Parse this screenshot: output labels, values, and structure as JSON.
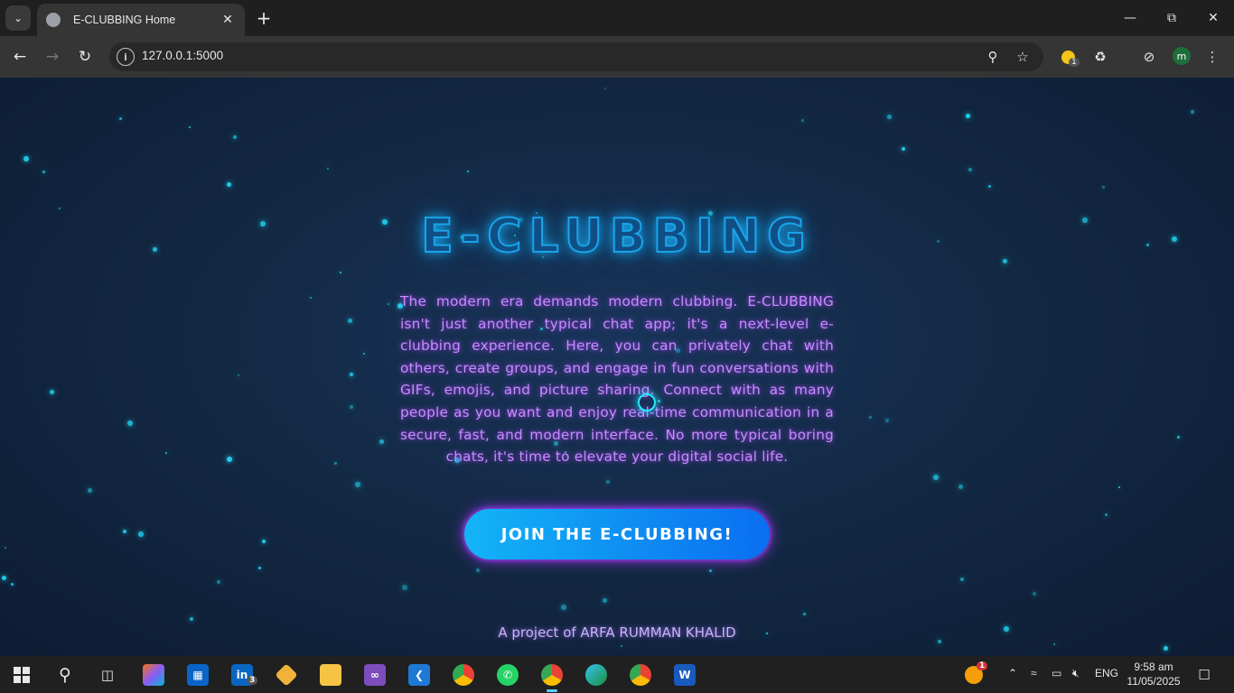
{
  "browser": {
    "tab_title": "E-CLUBBING Home",
    "url": "127.0.0.1:5000",
    "profile_initial": "m",
    "extension_badge": "1"
  },
  "page": {
    "title": "E-CLUBBING",
    "description": "The modern era demands modern clubbing. E-CLUBBING isn't just another typical chat app; it's a next-level e-clubbing experience. Here, you can privately chat with others, create groups, and engage in fun conversations with GIFs, emojis, and picture sharing. Connect with as many people as you want and enjoy real-time communication in a secure, fast, and modern interface. No more typical boring chats, it's time to elevate your digital social life.",
    "cta_label": "JOIN THE E-CLUBBING!",
    "footer": "A project of ARFA RUMMAN KHALID"
  },
  "taskbar": {
    "linkedin_badge": "3",
    "weather_badge": "1",
    "language": "ENG",
    "time": "9:58 am",
    "date": "11/05/2025"
  }
}
